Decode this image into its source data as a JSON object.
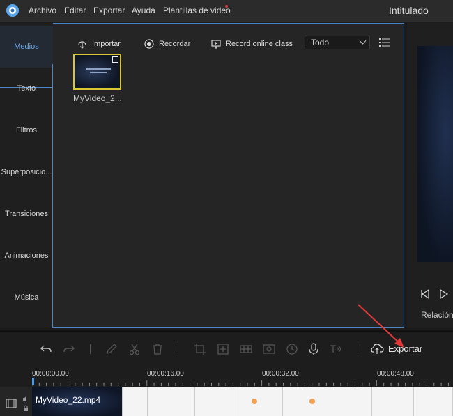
{
  "window": {
    "title": "Intitulado"
  },
  "menu": [
    "Archivo",
    "Editar",
    "Exportar",
    "Ayuda",
    "Plantillas de video"
  ],
  "sidebar": {
    "tabs": [
      "Medios",
      "Texto",
      "Filtros",
      "Superposicio...",
      "Transiciones",
      "Animaciones",
      "Música"
    ],
    "active": "Medios"
  },
  "media_toolbar": {
    "import_label": "Importar",
    "record_label": "Recordar",
    "online_label": "Record online class",
    "filter_value": "Todo"
  },
  "media_items": [
    {
      "name": "MyVideo_2..."
    }
  ],
  "preview": {
    "ratio_label": "Relación"
  },
  "edit_toolbar": {
    "export_label": "Exportar"
  },
  "timeline": {
    "ticks": [
      "00:00:00.00",
      "00:00:16.00",
      "00:00:32.00",
      "00:00:48.00"
    ],
    "clip_name": "MyVideo_22.mp4"
  },
  "colors": {
    "accent": "#4a86c5",
    "selection": "#d8c633",
    "annotation": "#e23a3a"
  }
}
